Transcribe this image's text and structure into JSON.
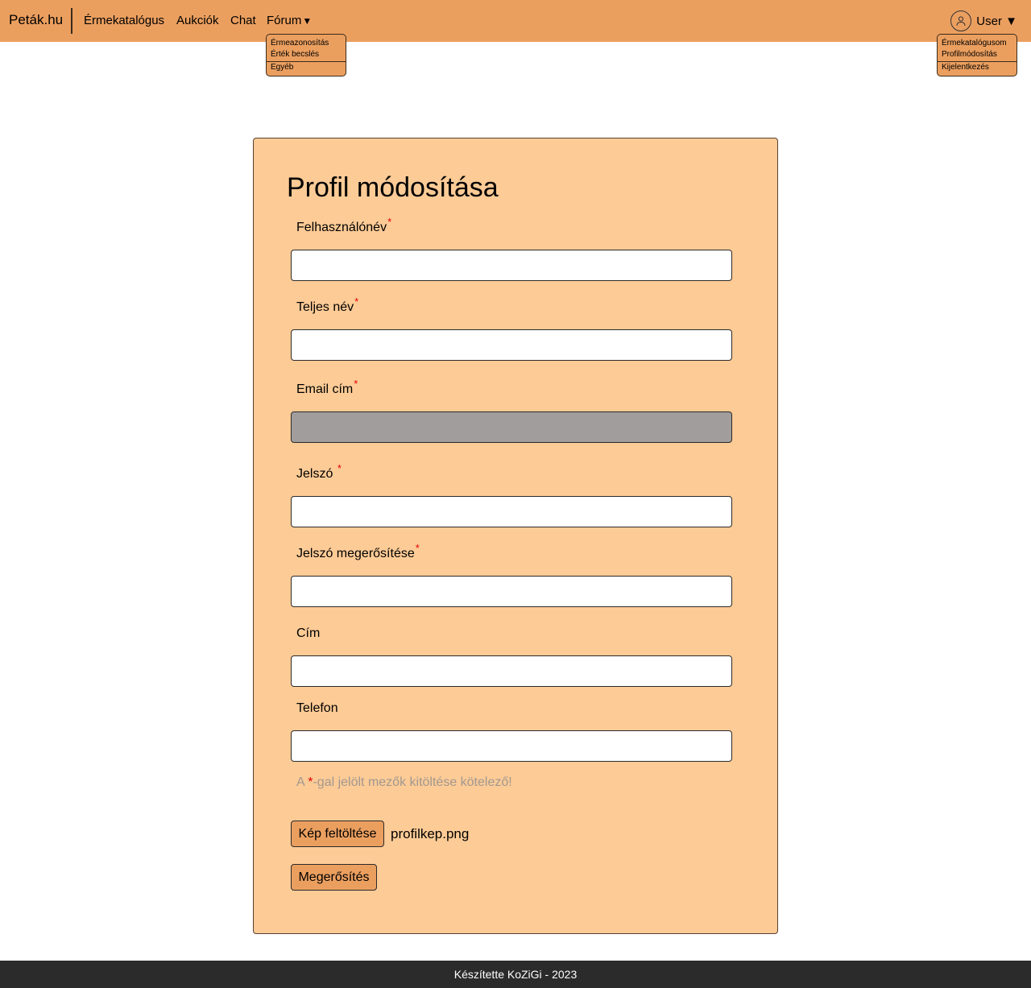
{
  "navbar": {
    "brand": "Peták.hu",
    "links": [
      "Érmekatalógus",
      "Aukciók",
      "Chat",
      "Fórum"
    ],
    "forum_caret": "▼",
    "user_label": "User",
    "user_caret": "▼",
    "background": "#eb9f5f"
  },
  "forum_menu": {
    "items": [
      "Érmeazonosítás",
      "Érték becslés",
      "Egyéb"
    ]
  },
  "user_menu": {
    "items": [
      "Érmekatalógusom",
      "Profilmódosítás",
      "Kijelentkezés"
    ]
  },
  "form": {
    "title": "Profil módosítása",
    "required_mark": "*",
    "fields": [
      {
        "label": "Felhasználónév",
        "required": true,
        "value": ""
      },
      {
        "label": "Teljes név",
        "required": true,
        "value": ""
      },
      {
        "label": "Email cím",
        "required": true,
        "value": "",
        "disabled": true
      },
      {
        "label": "Jelszó",
        "required": true,
        "value": ""
      },
      {
        "label": "Jelszó megerősítése",
        "required": true,
        "value": ""
      },
      {
        "label": "Cím",
        "required": false,
        "value": ""
      },
      {
        "label": "Telefon",
        "required": false,
        "value": ""
      }
    ],
    "note_prefix": "A ",
    "note_star": "*",
    "note_suffix": "-gal jelölt mezők kitöltése kötelező!",
    "upload_button": "Kép feltöltése",
    "uploaded_file": "profilkep.png",
    "confirm_button": "Megerősítés",
    "card_color": "#fdcb96"
  },
  "footer": {
    "text": "Készítette KoZiGi - 2023"
  }
}
